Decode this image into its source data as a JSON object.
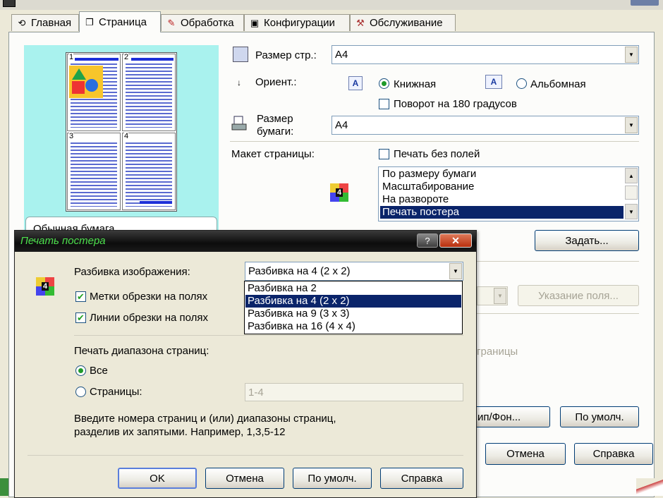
{
  "tabs": [
    {
      "label": "Главная",
      "icon": "main-icon"
    },
    {
      "label": "Страница",
      "icon": "page-icon"
    },
    {
      "label": "Обработка",
      "icon": "brush-icon"
    },
    {
      "label": "Конфигурации",
      "icon": "config-icon"
    },
    {
      "label": "Обслуживание",
      "icon": "maintenance-icon"
    }
  ],
  "preview": {
    "quadrant_numbers": [
      "1",
      "2",
      "3",
      "4"
    ],
    "paper_label": "Обычная бумага"
  },
  "page_size": {
    "label": "Размер стр.:",
    "value": "A4"
  },
  "orientation": {
    "label": "Ориент.:",
    "portrait_icon": "A",
    "portrait_label": "Книжная",
    "landscape_icon": "A",
    "landscape_label": "Альбомная",
    "selected": "portrait",
    "rotate_label": "Поворот на 180 градусов"
  },
  "paper_size": {
    "label_line1": "Размер",
    "label_line2": "бумаги:",
    "value": "A4"
  },
  "layout": {
    "label": "Макет страницы:",
    "borderless_label": "Печать без полей",
    "icon_text": "4",
    "items": [
      "По размеру бумаги",
      "Масштабирование",
      "На развороте",
      "Печать постера"
    ],
    "selected_index": 3,
    "set_button": "Задать..."
  },
  "background": {
    "margin_button": "Указание поля...",
    "pages_fragment": "границы",
    "stamp_button": "ип/Фон...",
    "defaults_button": "По умолч."
  },
  "main_buttons": {
    "cancel": "Отмена",
    "help": "Справка"
  },
  "dialog": {
    "title": "Печать постера",
    "help_glyph": "?",
    "close_glyph": "✕",
    "icon_text": "4",
    "split_label": "Разбивка изображения:",
    "split_value": "Разбивка на 4 (2 x 2)",
    "split_options": [
      "Разбивка на 2",
      "Разбивка на 4 (2 x 2)",
      "Разбивка на 9 (3 x 3)",
      "Разбивка на 16 (4 x 4)"
    ],
    "split_selected_index": 1,
    "trim_marks_label": "Метки обрезки на полях",
    "trim_marks_checked": true,
    "trim_lines_label": "Линии обрезки на полях",
    "trim_lines_checked": true,
    "range_label": "Печать диапазона страниц:",
    "all_label": "Все",
    "pages_label": "Страницы:",
    "pages_value": "1-4",
    "range_selected": "all",
    "hint_line1": "Введите номера страниц и (или) диапазоны страниц,",
    "hint_line2": "разделив их запятыми. Например, 1,3,5-12",
    "ok": "OK",
    "cancel": "Отмена",
    "defaults": "По умолч.",
    "help": "Справка"
  },
  "colors": {
    "selection": "#0a246a",
    "preview_bg": "#a9f2ee",
    "dialog_title_text": "#4de04d"
  }
}
